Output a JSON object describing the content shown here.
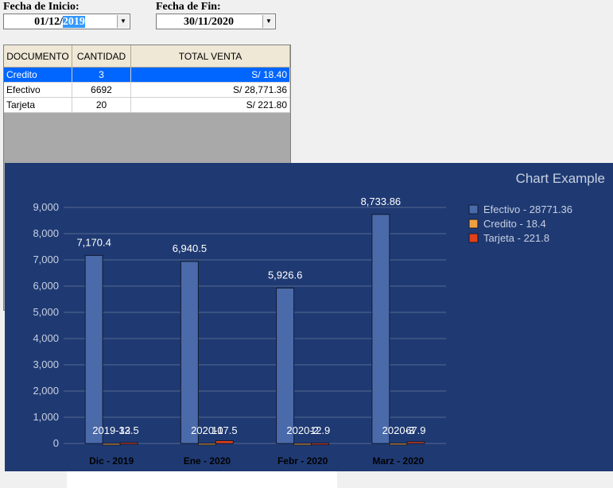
{
  "filters": {
    "start_label": "Fecha de Inicio:",
    "start_value_prefix": "01/12/",
    "start_value_selected": "2019",
    "end_label": "Fecha de Fin:",
    "end_value": "30/11/2020",
    "dropdown_glyph": "▼"
  },
  "table": {
    "headers": [
      "DOCUMENTO",
      "CANTIDAD",
      "TOTAL VENTA"
    ],
    "rows": [
      {
        "documento": "Credito",
        "cantidad": "3",
        "total": "S/ 18.40",
        "selected": true
      },
      {
        "documento": "Efectivo",
        "cantidad": "6692",
        "total": "S/ 28,771.36",
        "selected": false
      },
      {
        "documento": "Tarjeta",
        "cantidad": "20",
        "total": "S/ 221.80",
        "selected": false
      }
    ]
  },
  "colors": {
    "chart_bg": "#1f3a73",
    "efectivo": "#4a6aaa",
    "credito": "#f0a040",
    "tarjeta": "#e0401a",
    "selection": "#0066ff"
  },
  "chart_data": {
    "type": "bar",
    "title": "Chart Example",
    "categories": [
      "Dic - 2019",
      "Ene - 2020",
      "Febr - 2020",
      "Marz - 2020"
    ],
    "ylim": [
      0,
      9000
    ],
    "yticks": [
      "0",
      "1,000",
      "2,000",
      "3,000",
      "4,000",
      "5,000",
      "6,000",
      "7,000",
      "8,000",
      "9,000"
    ],
    "series": [
      {
        "name": "Efectivo - 28771.36",
        "values": [
          7170.4,
          6940.5,
          5926.6,
          8733.86
        ],
        "labels": [
          "7,170.4",
          "6,940.5",
          "5,926.6",
          "8,733.86"
        ]
      },
      {
        "name": "Credito - 18.4",
        "values": [
          3,
          5,
          3,
          7
        ],
        "labels": [
          "2019-12",
          "2020-1",
          "2020-2",
          "2020-3"
        ]
      },
      {
        "name": "Tarjeta - 221.8",
        "values": [
          33.5,
          107.5,
          12.9,
          67.9
        ],
        "labels": [
          "33.5",
          "107.5",
          "12.9",
          "67.9"
        ]
      }
    ],
    "grid": true,
    "legend": "top-right"
  }
}
